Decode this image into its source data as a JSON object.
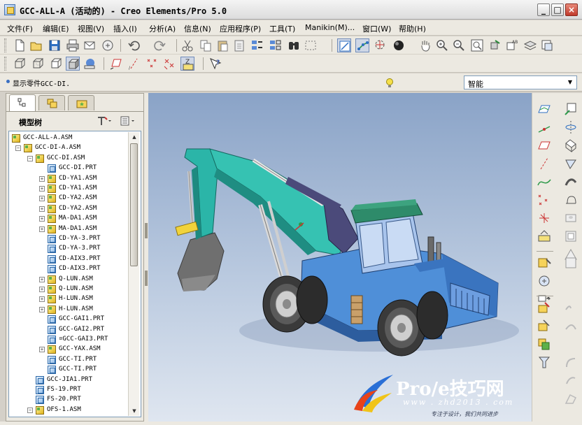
{
  "window": {
    "title": "GCC-ALL-A (活动的) - Creo Elements/Pro 5.0",
    "minimize": "_",
    "maximize": "□",
    "close": "×"
  },
  "menu": [
    "文件(F)",
    "编辑(E)",
    "视图(V)",
    "插入(I)",
    "分析(A)",
    "信息(N)",
    "应用程序(P)",
    "工具(T)",
    "Manikin(M)...",
    "窗口(W)",
    "帮助(H)"
  ],
  "status": {
    "message": "显示零件GCC-DI.",
    "filter_value": "智能"
  },
  "panel": {
    "title": "模型树",
    "tabs": [
      "model-tree-tab",
      "layer-tab",
      "favorites-tab"
    ]
  },
  "tree": [
    {
      "label": "GCC-ALL-A.ASM",
      "type": "asm",
      "level": 0,
      "expander": ""
    },
    {
      "label": "GCC-DI-A.ASM",
      "type": "asm",
      "level": 1,
      "expander": "−"
    },
    {
      "label": "GCC-DI.ASM",
      "type": "asm",
      "level": 2,
      "expander": "−"
    },
    {
      "label": "GCC-DI.PRT",
      "type": "prt",
      "level": 3,
      "expander": ""
    },
    {
      "label": "CD-YA1.ASM",
      "type": "asm",
      "level": 3,
      "expander": "+"
    },
    {
      "label": "CD-YA1.ASM",
      "type": "asm",
      "level": 3,
      "expander": "+"
    },
    {
      "label": "CD-YA2.ASM",
      "type": "asm",
      "level": 3,
      "expander": "+"
    },
    {
      "label": "CD-YA2.ASM",
      "type": "asm",
      "level": 3,
      "expander": "+"
    },
    {
      "label": "MA-DA1.ASM",
      "type": "asm",
      "level": 3,
      "expander": "+"
    },
    {
      "label": "MA-DA1.ASM",
      "type": "asm",
      "level": 3,
      "expander": "+"
    },
    {
      "label": "CD-YA-3.PRT",
      "type": "prt",
      "level": 3,
      "expander": ""
    },
    {
      "label": "CD-YA-3.PRT",
      "type": "prt",
      "level": 3,
      "expander": ""
    },
    {
      "label": "CD-AIX3.PRT",
      "type": "prt",
      "level": 3,
      "expander": ""
    },
    {
      "label": "CD-AIX3.PRT",
      "type": "prt",
      "level": 3,
      "expander": ""
    },
    {
      "label": "Q-LUN.ASM",
      "type": "asm",
      "level": 3,
      "expander": "+"
    },
    {
      "label": "Q-LUN.ASM",
      "type": "asm",
      "level": 3,
      "expander": "+"
    },
    {
      "label": "H-LUN.ASM",
      "type": "asm",
      "level": 3,
      "expander": "+"
    },
    {
      "label": "H-LUN.ASM",
      "type": "asm",
      "level": 3,
      "expander": "+"
    },
    {
      "label": "GCC-GAI1.PRT",
      "type": "prt",
      "level": 3,
      "expander": ""
    },
    {
      "label": "GCC-GAI2.PRT",
      "type": "prt",
      "level": 3,
      "expander": ""
    },
    {
      "label": "¤GCC-GAI3.PRT",
      "type": "prt",
      "level": 3,
      "expander": ""
    },
    {
      "label": "GCC-YAX.ASM",
      "type": "asm",
      "level": 3,
      "expander": "+"
    },
    {
      "label": "GCC-TI.PRT",
      "type": "prt",
      "level": 3,
      "expander": ""
    },
    {
      "label": "GCC-TI.PRT",
      "type": "prt",
      "level": 3,
      "expander": ""
    },
    {
      "label": "GCC-JIA1.PRT",
      "type": "prt",
      "level": 2,
      "expander": ""
    },
    {
      "label": "FS-19.PRT",
      "type": "prt",
      "level": 2,
      "expander": ""
    },
    {
      "label": "FS-20.PRT",
      "type": "prt",
      "level": 2,
      "expander": ""
    },
    {
      "label": "OFS-1.ASM",
      "type": "asm",
      "level": 2,
      "expander": "−"
    }
  ],
  "watermark": {
    "title": "Pro/e技巧网",
    "url": "www . zhd2013 . com",
    "slogan": "专注于设计，我们共同进步"
  },
  "colors": {
    "viewport_top": "#8aa3c7",
    "viewport_bottom": "#dfe6f0",
    "boom": "#2bb5a8",
    "body": "#4f8fd8",
    "roof": "#2e8b6a"
  },
  "toolbar_icons": [
    "new-file-icon",
    "open-file-icon",
    "save-icon",
    "print-icon",
    "send-mail-icon",
    "copy-mail-icon",
    "undo-icon",
    "redo-icon",
    "cut-icon",
    "copy-icon",
    "paste-icon",
    "paste-special-icon",
    "regenerate-icon",
    "regenerate-manager-icon",
    "find-icon",
    "select-box-icon",
    "datum-plane-display-icon",
    "datum-axis-display-icon",
    "spin-center-icon",
    "shading-icon",
    "pan-icon",
    "zoom-in-icon",
    "zoom-out-icon",
    "refit-icon",
    "orient-icon",
    "saved-views-icon",
    "layers-icon",
    "view-manager-icon"
  ]
}
